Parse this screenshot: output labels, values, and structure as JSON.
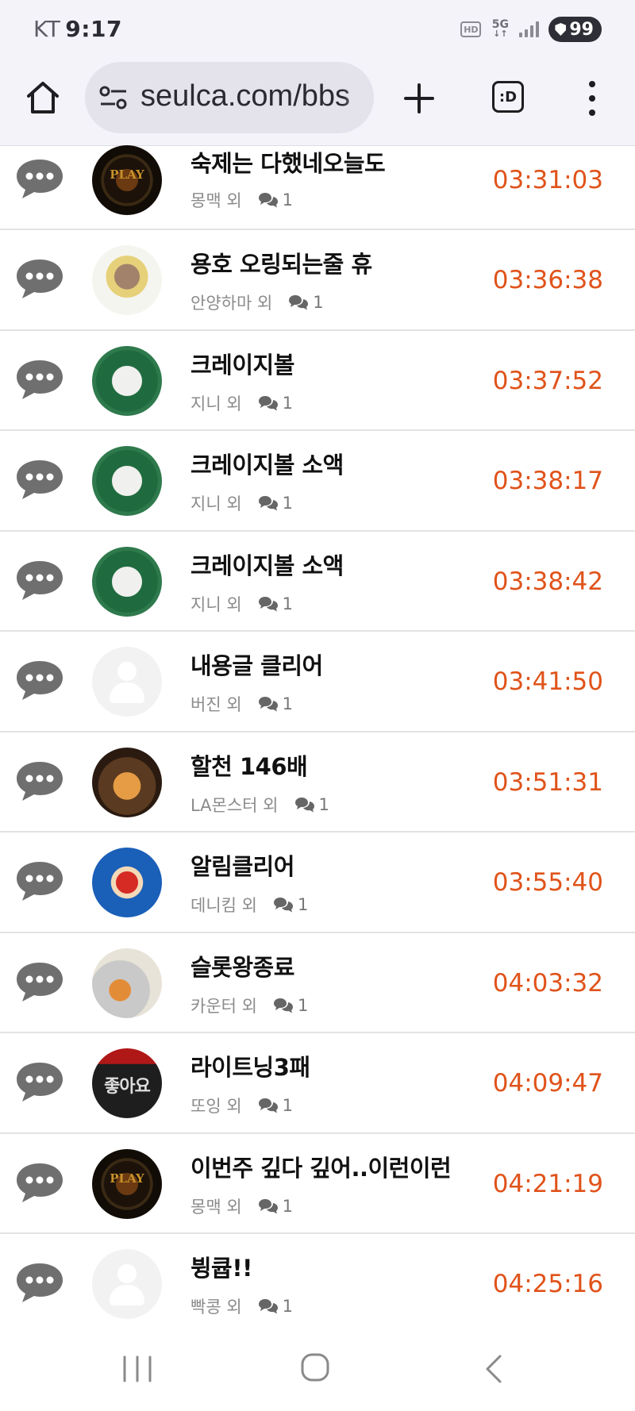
{
  "status_bar": {
    "carrier": "KT",
    "time": "9:17",
    "hd_label": "HD",
    "network_label": "5G",
    "battery": "99"
  },
  "browser": {
    "url": "seulca.com/bbs",
    "tab_switcher_label": ":D"
  },
  "posts": [
    {
      "title": "숙제는 다했네오늘도",
      "author": "몽맥 외",
      "comments": "1",
      "time": "03:31:03",
      "avatar": "play-logo"
    },
    {
      "title": "용호 오링되는줄 휴",
      "author": "안양하마 외",
      "comments": "1",
      "time": "03:36:38",
      "avatar": "hamster"
    },
    {
      "title": "크레이지볼",
      "author": "지니 외",
      "comments": "1",
      "time": "03:37:52",
      "avatar": "starbucks"
    },
    {
      "title": "크레이지볼 소액",
      "author": "지니 외",
      "comments": "1",
      "time": "03:38:17",
      "avatar": "starbucks"
    },
    {
      "title": "크레이지볼 소액",
      "author": "지니 외",
      "comments": "1",
      "time": "03:38:42",
      "avatar": "starbucks"
    },
    {
      "title": "내용글 클리어",
      "author": "버진 외",
      "comments": "1",
      "time": "03:41:50",
      "avatar": "default"
    },
    {
      "title": "할천 146배",
      "author": "LA몬스터 외",
      "comments": "1",
      "time": "03:51:31",
      "avatar": "fox"
    },
    {
      "title": "알림클리어",
      "author": "데니킴 외",
      "comments": "1",
      "time": "03:55:40",
      "avatar": "bird"
    },
    {
      "title": "슬롯왕종료",
      "author": "카운터 외",
      "comments": "1",
      "time": "04:03:32",
      "avatar": "dragon"
    },
    {
      "title": "라이트닝3패",
      "author": "또잉 외",
      "comments": "1",
      "time": "04:09:47",
      "avatar": "like"
    },
    {
      "title": "이번주 깊다 깊어..이런이런",
      "author": "몽맥 외",
      "comments": "1",
      "time": "04:21:19",
      "avatar": "play-logo"
    },
    {
      "title": "뷩큡!!",
      "author": "빡콩 외",
      "comments": "1",
      "time": "04:25:16",
      "avatar": "default"
    }
  ],
  "avatar_text": {
    "play_logo": "PLAY",
    "like": "좋아요"
  },
  "colors": {
    "time_accent": "#e0531a",
    "chat_icon": "#6f6f6f",
    "browser_chrome": "#f4f3fa"
  },
  "icons": {
    "home": "home-icon",
    "site_info": "tune-icon",
    "new_tab": "plus-icon",
    "menu": "more-vertical-icon",
    "post_type": "chat-bubble-icon",
    "comment": "comments-icon"
  }
}
